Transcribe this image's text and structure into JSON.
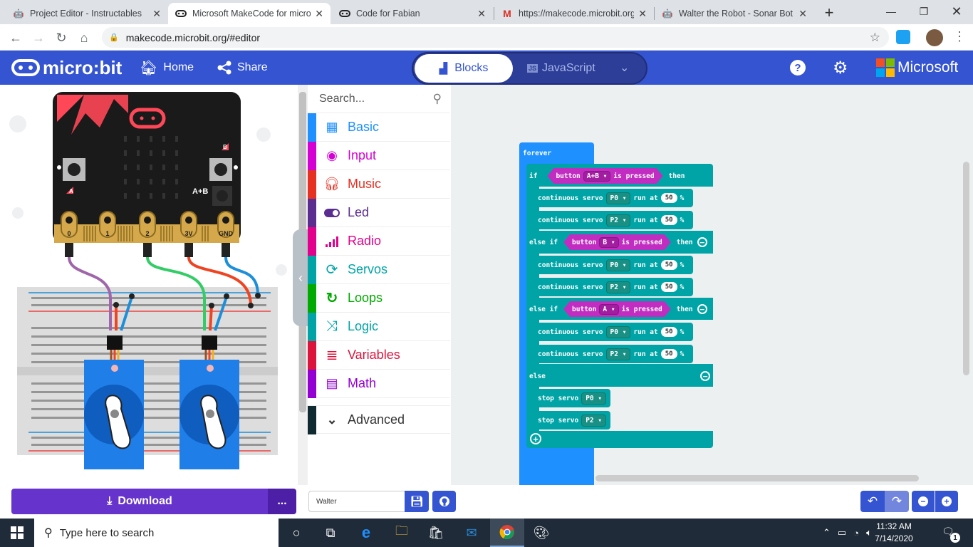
{
  "browser": {
    "tabs": [
      {
        "title": "Project Editor - Instructables",
        "icon": "instructables-icon"
      },
      {
        "title": "Microsoft MakeCode for micro",
        "icon": "makecode-icon"
      },
      {
        "title": "Code for Fabian",
        "icon": "makecode-icon"
      },
      {
        "title": "https://makecode.microbit.org",
        "icon": "gmail-icon"
      },
      {
        "title": "Walter the Robot - Sonar Bot -",
        "icon": "instructables-icon"
      }
    ],
    "url": "makecode.microbit.org/#editor"
  },
  "header": {
    "logo": "micro:bit",
    "home": "Home",
    "share": "Share",
    "blocks": "Blocks",
    "javascript": "JavaScript",
    "brand": "Microsoft"
  },
  "toolbox": {
    "search_placeholder": "Search...",
    "categories": [
      {
        "label": "Basic",
        "color": "#1e90ff"
      },
      {
        "label": "Input",
        "color": "#d400d4"
      },
      {
        "label": "Music",
        "color": "#e63022"
      },
      {
        "label": "Led",
        "color": "#5c2d91"
      },
      {
        "label": "Radio",
        "color": "#e3008c"
      },
      {
        "label": "Servos",
        "color": "#00a4a6"
      },
      {
        "label": "Loops",
        "color": "#00aa00"
      },
      {
        "label": "Logic",
        "color": "#00a4a6"
      },
      {
        "label": "Variables",
        "color": "#dc143c"
      },
      {
        "label": "Math",
        "color": "#9400d3"
      }
    ],
    "advanced": "Advanced"
  },
  "simulator": {
    "pins": [
      "0",
      "1",
      "2",
      "3V",
      "GND"
    ],
    "button_ab": "A+B",
    "button_a": "A",
    "button_b": "B"
  },
  "code": {
    "forever": "forever",
    "if": "if",
    "then": "then",
    "else_if": "else if",
    "else": "else",
    "button": "button",
    "is_pressed": "is pressed",
    "cond1": "A+B",
    "cond2": "B",
    "cond3": "A",
    "continuous_servo": "continuous servo",
    "run_at": "run at",
    "percent": "%",
    "stop_servo": "stop servo",
    "pin0": "P0",
    "pin2": "P2",
    "speed": "50"
  },
  "bottom": {
    "download": "Download",
    "more": "...",
    "project_name": "Walter"
  },
  "taskbar": {
    "search_placeholder": "Type here to search",
    "time": "11:32 AM",
    "date": "7/14/2020",
    "notifications": "1"
  }
}
